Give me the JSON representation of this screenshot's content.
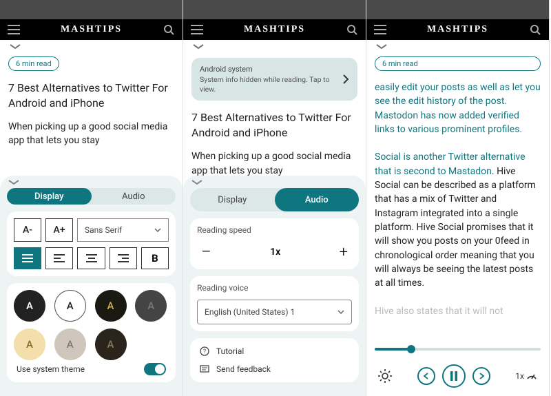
{
  "brand": "MASHTIPS",
  "readTime": "6 min read",
  "article": {
    "title": "7 Best Alternatives to Twitter For Android and iPhone",
    "intro": "When picking up a good social media app that lets you stay"
  },
  "notif": {
    "title": "Android system",
    "body": "System info hidden while reading. Tap to view."
  },
  "tabs": {
    "display": "Display",
    "audio": "Audio"
  },
  "displayPanel": {
    "smaller": "A-",
    "larger": "A+",
    "font": "Sans Serif",
    "bold": "B",
    "themes": [
      {
        "bg": "#222",
        "fg": "#fff",
        "border": "0"
      },
      {
        "bg": "#fff",
        "fg": "#222",
        "border": "1.5px solid #555"
      },
      {
        "bg": "#1a1a12",
        "fg": "#d6b24a",
        "border": "0"
      },
      {
        "bg": "#444",
        "fg": "#777",
        "border": "0"
      },
      {
        "bg": "#f4deab",
        "fg": "#8a6b2a",
        "border": "0"
      },
      {
        "bg": "#d0c7bc",
        "fg": "#777",
        "border": "0"
      },
      {
        "bg": "#2a241c",
        "fg": "#8a7a5a",
        "border": "0"
      }
    ],
    "sysTheme": "Use system theme"
  },
  "audioPanel": {
    "speedLabel": "Reading speed",
    "speedVal": "1x",
    "voiceLabel": "Reading voice",
    "voice": "English (United States) 1",
    "tutorial": "Tutorial",
    "feedback": "Send feedback"
  },
  "p3": {
    "link1": "easily edit your posts as well as let you see the edit history of the post. Mastodon has now added verified links to various prominent profiles.",
    "link2": "Social is another Twitter alternative that is second to Mastadon",
    "para": ". Hive Social can be described as a platform that has a mix of Twitter and Instagram integrated into a single platform. Hive Social promises that it will show you posts on your 0feed in chronological order meaning that you will always be seeing the latest posts at all times.",
    "fade": "Hive also states that it will not",
    "rate": "1x"
  }
}
